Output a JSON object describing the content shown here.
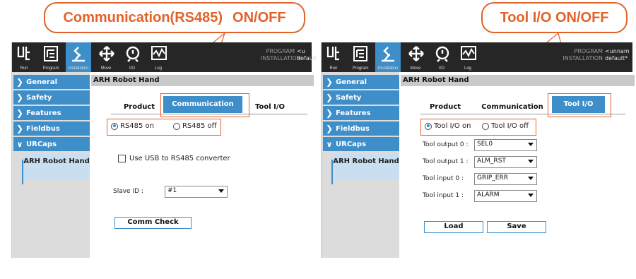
{
  "callouts": {
    "left_text": "Communication(RS485)",
    "left_suffix": "ON/OFF",
    "right_text": "Tool I/O ON/OFF"
  },
  "colors": {
    "accent": "#e3622a",
    "ur_blue": "#3e8ec9",
    "topbar": "#262626"
  },
  "toolbar": {
    "items": [
      {
        "label": "Run",
        "icon": "ur-logo-icon"
      },
      {
        "label": "Program",
        "icon": "program-icon"
      },
      {
        "label": "Installation",
        "icon": "installation-icon"
      },
      {
        "label": "Move",
        "icon": "move-icon"
      },
      {
        "label": "I/O",
        "icon": "io-icon"
      },
      {
        "label": "Log",
        "icon": "log-icon"
      }
    ],
    "program_label": "PROGRAM",
    "installation_label": "INSTALLATION",
    "left_program_value": "<u",
    "left_installation_value": "default",
    "right_program_value": "<unnam",
    "right_installation_value": "default*"
  },
  "sidebar": {
    "items": [
      "General",
      "Safety",
      "Features",
      "Fieldbus",
      "URCaps"
    ],
    "sub_item": "ARH Robot Hand"
  },
  "left_panel": {
    "header": "ARH Robot Hand",
    "tabs": [
      "Product",
      "Communication",
      "Tool I/O"
    ],
    "active_tab": "Communication",
    "radio_on": "RS485 on",
    "radio_off": "RS485 off",
    "usb_checkbox": "Use USB to RS485 converter",
    "slave_id_label": "Slave ID :",
    "slave_id_value": "#1",
    "comm_check_button": "Comm Check"
  },
  "right_panel": {
    "header": "ARH Robot Hand",
    "tabs": [
      "Product",
      "Communication",
      "Tool I/O"
    ],
    "active_tab": "Tool I/O",
    "radio_on": "Tool I/O on",
    "radio_off": "Tool I/O off",
    "rows": [
      {
        "label": "Tool output 0 :",
        "value": "SEL0"
      },
      {
        "label": "Tool output 1 :",
        "value": "ALM_RST"
      },
      {
        "label": "Tool input 0 :",
        "value": "GRIP_ERR"
      },
      {
        "label": "Tool input 1 :",
        "value": "ALARM"
      }
    ],
    "load_button": "Load",
    "save_button": "Save"
  }
}
